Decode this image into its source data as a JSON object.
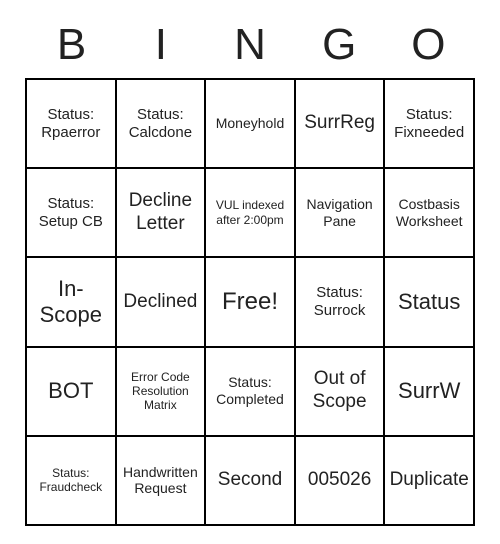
{
  "header": [
    "B",
    "I",
    "N",
    "G",
    "O"
  ],
  "cells": [
    [
      {
        "text": "Status: Rpaerror",
        "cls": "fs-md"
      },
      {
        "text": "Status: Calcdone",
        "cls": "fs-md"
      },
      {
        "text": "Moneyhold",
        "cls": ""
      },
      {
        "text": "SurrReg",
        "cls": "fs-lg"
      },
      {
        "text": "Status: Fixneeded",
        "cls": "fs-md"
      }
    ],
    [
      {
        "text": "Status: Setup CB",
        "cls": "fs-md"
      },
      {
        "text": "Decline Letter",
        "cls": "fs-lg"
      },
      {
        "text": "VUL indexed after 2:00pm",
        "cls": "fs-sm"
      },
      {
        "text": "Navigation Pane",
        "cls": ""
      },
      {
        "text": "Costbasis Worksheet",
        "cls": ""
      }
    ],
    [
      {
        "text": "In-Scope",
        "cls": "fs-xl"
      },
      {
        "text": "Declined",
        "cls": "fs-lg"
      },
      {
        "text": "Free!",
        "cls": "free"
      },
      {
        "text": "Status: Surrock",
        "cls": "fs-md"
      },
      {
        "text": "Status",
        "cls": "fs-xl"
      }
    ],
    [
      {
        "text": "BOT",
        "cls": "fs-xl"
      },
      {
        "text": "Error Code Resolution Matrix",
        "cls": "fs-sm"
      },
      {
        "text": "Status: Completed",
        "cls": ""
      },
      {
        "text": "Out of Scope",
        "cls": "fs-lg"
      },
      {
        "text": "SurrW",
        "cls": "fs-xl"
      }
    ],
    [
      {
        "text": "Status: Fraudcheck",
        "cls": "fs-sm"
      },
      {
        "text": "Handwritten Request",
        "cls": ""
      },
      {
        "text": "Second",
        "cls": "fs-lg"
      },
      {
        "text": "005026",
        "cls": "fs-lg"
      },
      {
        "text": "Duplicate",
        "cls": "fs-lg"
      }
    ]
  ]
}
